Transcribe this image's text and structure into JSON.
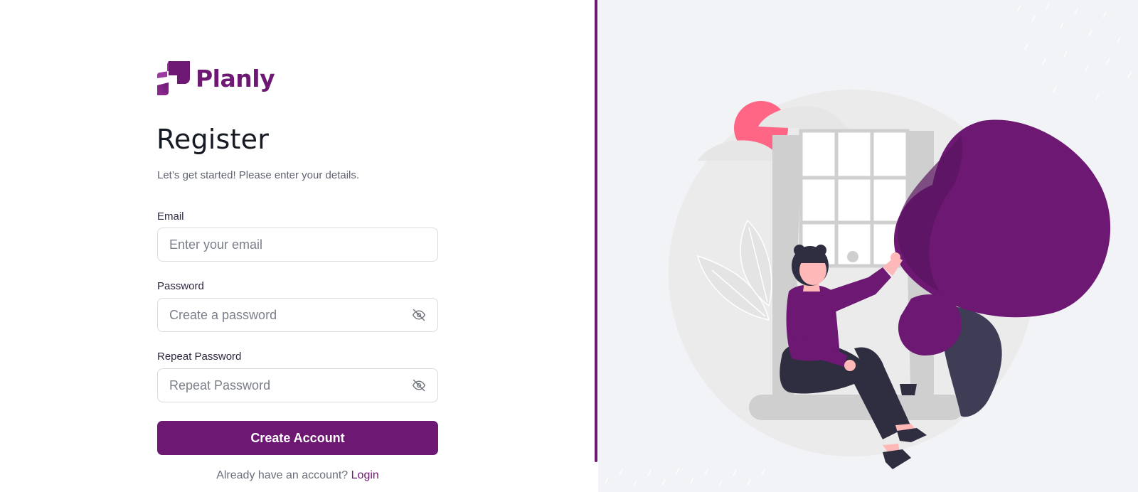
{
  "brand": {
    "name": "Planly",
    "color": "#6d1872"
  },
  "form": {
    "title": "Register",
    "subtitle": "Let’s get started! Please enter your details.",
    "email": {
      "label": "Email",
      "placeholder": "Enter your email",
      "value": ""
    },
    "password": {
      "label": "Password",
      "placeholder": "Create a password",
      "value": "",
      "icon": "eye-off-icon"
    },
    "repeat_password": {
      "label": "Repeat Password",
      "placeholder": "Repeat Password",
      "value": "",
      "icon": "eye-off-icon"
    },
    "submit_label": "Create Account",
    "footer_text": "Already have an account?",
    "login_link": "Login"
  },
  "illustration": {
    "description_icon": "woman-at-window-illustration",
    "accent_color": "#6d1872",
    "sun_color": "#ff6584"
  }
}
